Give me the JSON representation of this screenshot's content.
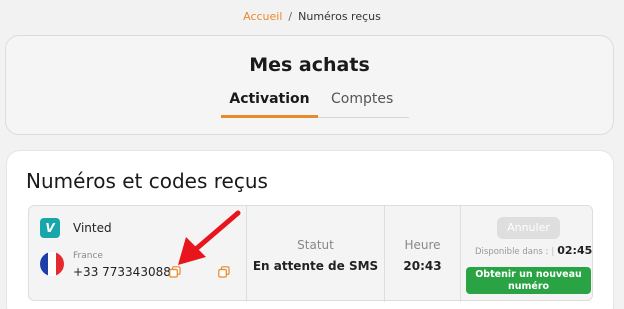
{
  "breadcrumb": {
    "home": "Accueil",
    "separator": "/",
    "current": "Numéros reçus"
  },
  "purchases": {
    "title": "Mes achats",
    "tabs": [
      {
        "label": "Activation",
        "active": true
      },
      {
        "label": "Comptes",
        "active": false
      }
    ],
    "accent_color": "#e8892c"
  },
  "received": {
    "heading": "Numéros et codes reçus",
    "order": {
      "service_logo_letter": "V",
      "service_name": "Vinted",
      "service_color": "#17a6a9",
      "country": "France",
      "flag_icon": "france-flag-icon",
      "phone": "+33 773343088",
      "status_label": "Statut",
      "status_value": "En attente de SMS",
      "time_label": "Heure",
      "time_value": "20:43",
      "cancel_label": "Annuler",
      "available_label": "Disponible dans :",
      "available_divider": "|",
      "countdown": "02:45",
      "new_number_label": "Obtenir un nouveau numéro",
      "new_number_color": "#29a344"
    }
  },
  "annotation": {
    "arrow_color": "#e8161c",
    "icon": "red-arrow-icon"
  }
}
